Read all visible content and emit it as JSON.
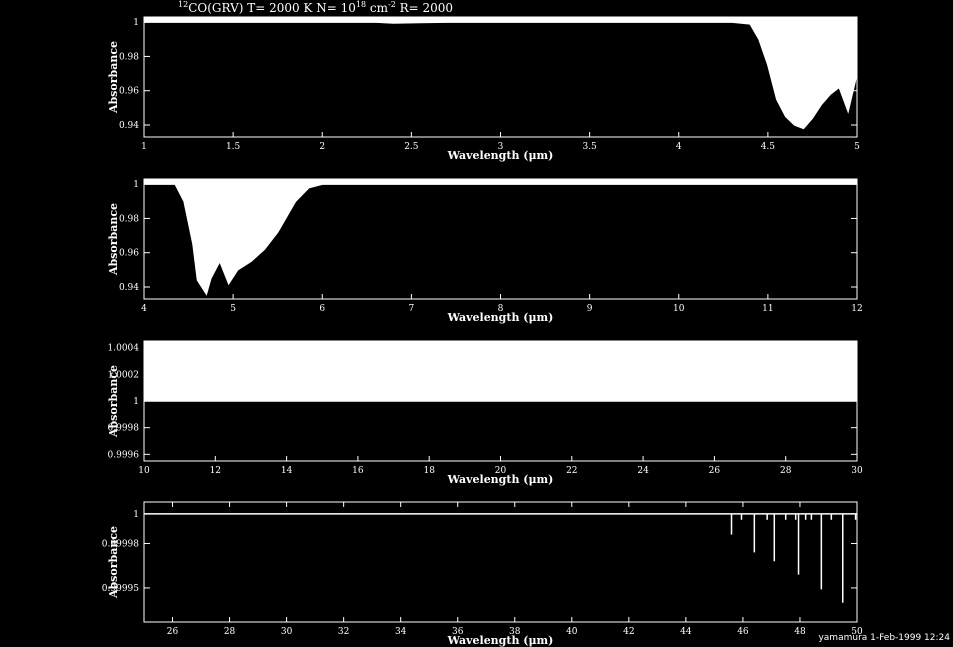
{
  "title_prefix_sup": "12",
  "title_main": "CO(GRV) T= 2000 K N= 10",
  "title_n_exp": "18",
  "title_unit": " cm",
  "title_unit_exp": "-2",
  "title_suffix": " R= 2000",
  "footer": "yamamura  1-Feb-1999 12:24",
  "colors": {
    "background": "#000000",
    "foreground": "#ffffff"
  },
  "chart_data": [
    {
      "type": "line",
      "xlabel": "Wavelength (μm)",
      "ylabel": "Absorbance",
      "xlim": [
        1,
        5
      ],
      "ylim": [
        0.933,
        1.003
      ],
      "xticks": [
        1,
        1.5,
        2,
        2.5,
        3,
        3.5,
        4,
        4.5,
        5
      ],
      "xtick_labels": [
        "1",
        "1.5",
        "2",
        "2.5",
        "3",
        "3.5",
        "4",
        "4.5",
        "5"
      ],
      "yticks": [
        0.94,
        0.96,
        0.98,
        1
      ],
      "ytick_labels": [
        "0.94",
        "0.96",
        "0.98",
        "1"
      ],
      "x": [
        1,
        2.3,
        2.4,
        2.55,
        2.7,
        4.3,
        4.4,
        4.45,
        4.5,
        4.55,
        4.6,
        4.65,
        4.7,
        4.75,
        4.8,
        4.85,
        4.9,
        4.95,
        5
      ],
      "y": [
        1,
        1,
        0.9995,
        0.9998,
        1,
        1,
        0.999,
        0.99,
        0.975,
        0.955,
        0.945,
        0.94,
        0.938,
        0.944,
        0.952,
        0.958,
        0.962,
        0.948,
        0.97
      ]
    },
    {
      "type": "line",
      "xlabel": "Wavelength (μm)",
      "ylabel": "Absorbance",
      "xlim": [
        4,
        12
      ],
      "ylim": [
        0.933,
        1.003
      ],
      "xticks": [
        4,
        5,
        6,
        7,
        8,
        9,
        10,
        11,
        12
      ],
      "xtick_labels": [
        "4",
        "5",
        "6",
        "7",
        "8",
        "9",
        "10",
        "11",
        "12"
      ],
      "yticks": [
        0.94,
        0.96,
        0.98,
        1
      ],
      "ytick_labels": [
        "0.94",
        "0.96",
        "0.98",
        "1"
      ],
      "x": [
        4,
        4.35,
        4.45,
        4.55,
        4.6,
        4.65,
        4.7,
        4.75,
        4.85,
        4.95,
        5.05,
        5.2,
        5.35,
        5.5,
        5.7,
        5.85,
        6,
        12
      ],
      "y": [
        1,
        1,
        0.99,
        0.965,
        0.944,
        0.94,
        0.936,
        0.945,
        0.955,
        0.942,
        0.95,
        0.955,
        0.962,
        0.972,
        0.99,
        0.998,
        1,
        1
      ]
    },
    {
      "type": "line",
      "xlabel": "Wavelength (μm)",
      "ylabel": "Absorbance",
      "xlim": [
        10,
        30
      ],
      "ylim": [
        0.99955,
        1.00045
      ],
      "xticks": [
        10,
        12,
        14,
        16,
        18,
        20,
        22,
        24,
        26,
        28,
        30
      ],
      "xtick_labels": [
        "10",
        "12",
        "14",
        "16",
        "18",
        "20",
        "22",
        "24",
        "26",
        "28",
        "30"
      ],
      "yticks": [
        0.9996,
        0.9998,
        1,
        1.0002,
        1.0004
      ],
      "ytick_labels": [
        "0.9996",
        "0.9998",
        "1",
        "1.0002",
        "1.0004"
      ],
      "x": [
        10,
        30
      ],
      "y": [
        1,
        1
      ]
    },
    {
      "type": "line",
      "xlabel": "Wavelength (μm)",
      "ylabel": "Absorbance",
      "xlim": [
        25,
        50
      ],
      "ylim": [
        0.999927,
        1.000008
      ],
      "xticks": [
        26,
        28,
        30,
        32,
        34,
        36,
        38,
        40,
        42,
        44,
        46,
        48,
        50
      ],
      "xtick_labels": [
        "26",
        "28",
        "30",
        "32",
        "34",
        "36",
        "38",
        "40",
        "42",
        "44",
        "46",
        "48",
        "50"
      ],
      "yticks": [
        0.99995,
        0.99998,
        1
      ],
      "ytick_labels": [
        "0.99995",
        "0.99998",
        "1"
      ],
      "lines": [
        {
          "x": 45.6,
          "y": 0.999986
        },
        {
          "x": 45.95,
          "y": 0.999996
        },
        {
          "x": 46.4,
          "y": 0.999974
        },
        {
          "x": 46.85,
          "y": 0.999996
        },
        {
          "x": 47.1,
          "y": 0.999968
        },
        {
          "x": 47.5,
          "y": 0.999996
        },
        {
          "x": 47.85,
          "y": 0.999996
        },
        {
          "x": 47.95,
          "y": 0.999959
        },
        {
          "x": 48.2,
          "y": 0.999996
        },
        {
          "x": 48.4,
          "y": 0.999996
        },
        {
          "x": 48.75,
          "y": 0.999949
        },
        {
          "x": 49.1,
          "y": 0.999996
        },
        {
          "x": 49.5,
          "y": 0.99994
        },
        {
          "x": 49.95,
          "y": 0.999996
        }
      ]
    }
  ]
}
